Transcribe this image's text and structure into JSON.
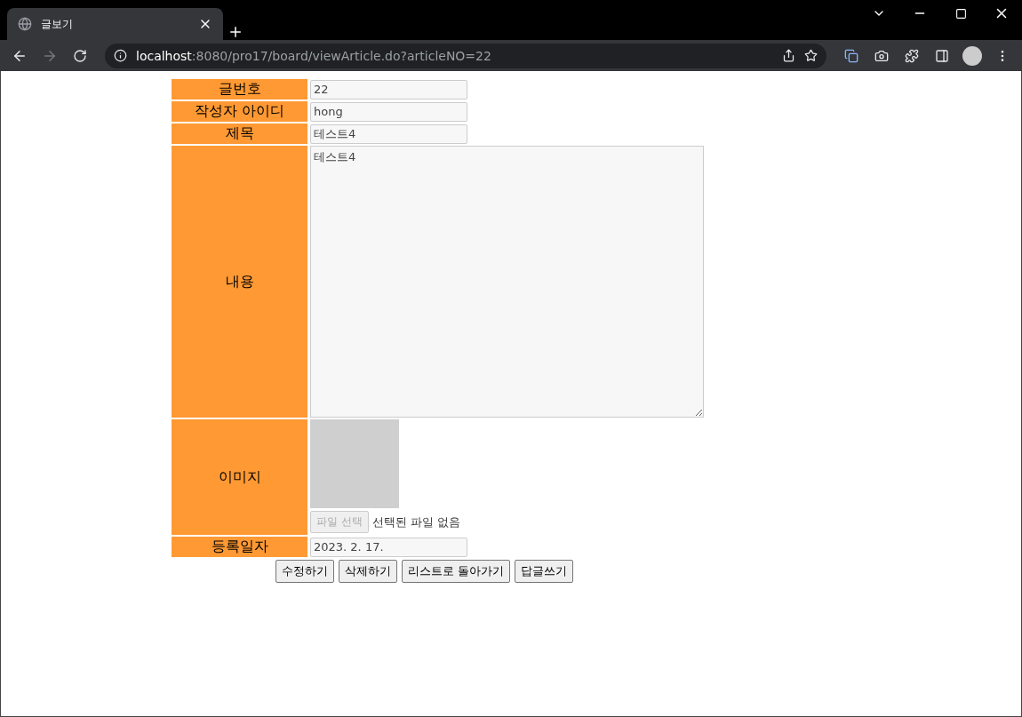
{
  "browser": {
    "tab_title": "글보기",
    "url_host": "localhost",
    "url_path": ":8080/pro17/board/viewArticle.do?articleNO=22"
  },
  "rows": [
    {
      "kind": "input",
      "label": "글번호",
      "value": "22",
      "disabled": true
    },
    {
      "kind": "input",
      "label": "작성자 아이디",
      "value": "hong",
      "disabled": true
    },
    {
      "kind": "input",
      "label": "제목",
      "value": "테스트4",
      "disabled": true
    },
    {
      "kind": "textarea",
      "label": "내용",
      "value": "테스트4",
      "disabled": true
    },
    {
      "kind": "image",
      "label": "이미지",
      "file_button": "파일 선택",
      "file_status": "선택된 파일 없음",
      "disabled": true
    },
    {
      "kind": "input",
      "label": "등록일자",
      "value": "2023. 2. 17.",
      "disabled": true
    }
  ],
  "buttons": [
    "수정하기",
    "삭제하기",
    "리스트로 돌아가기",
    "답글쓰기"
  ]
}
